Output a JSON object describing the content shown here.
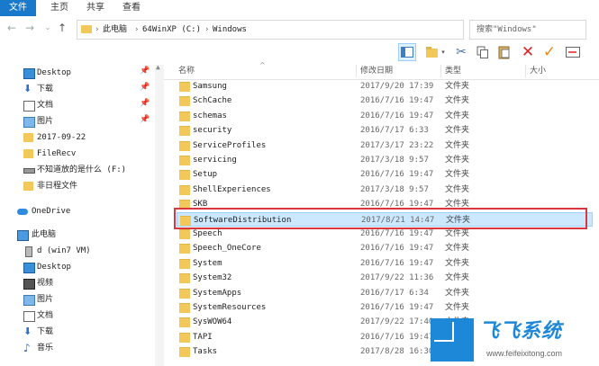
{
  "ribbon": {
    "tabs": [
      "文件",
      "主页",
      "共享",
      "查看"
    ]
  },
  "address": {
    "crumbs": [
      "此电脑",
      "64WinXP (C:)",
      "Windows"
    ],
    "search_placeholder": "搜索\"Windows\""
  },
  "nav": {
    "items": [
      {
        "label": "Desktop",
        "icon": "desktop-icon",
        "pinned": true
      },
      {
        "label": "下载",
        "icon": "download-arrow-icon",
        "pinned": true
      },
      {
        "label": "文档",
        "icon": "document-icon",
        "pinned": true
      },
      {
        "label": "图片",
        "icon": "picture-icon",
        "pinned": true
      },
      {
        "label": "2017-09-22",
        "icon": "folder-icon",
        "pinned": false
      },
      {
        "label": "FileRecv",
        "icon": "folder-icon",
        "pinned": false
      },
      {
        "label": "不知道放的是什么 (F:)",
        "icon": "drive-icon",
        "pinned": false
      },
      {
        "label": "非日程文件",
        "icon": "folder-icon",
        "pinned": false
      },
      {
        "label": "OneDrive",
        "icon": "cloud-icon",
        "pinned": false
      },
      {
        "label": "此电脑",
        "icon": "computer-icon",
        "pinned": false
      },
      {
        "label": "d (win7 VM)",
        "icon": "usb-drive-icon",
        "pinned": false
      },
      {
        "label": "Desktop",
        "icon": "desktop-icon",
        "pinned": false
      },
      {
        "label": "视频",
        "icon": "video-icon",
        "pinned": false
      },
      {
        "label": "图片",
        "icon": "picture-icon",
        "pinned": false
      },
      {
        "label": "文档",
        "icon": "document-icon",
        "pinned": false
      },
      {
        "label": "下载",
        "icon": "download-arrow-icon",
        "pinned": false
      },
      {
        "label": "音乐",
        "icon": "music-note-icon",
        "pinned": false
      }
    ]
  },
  "columns": {
    "name": "名称",
    "date": "修改日期",
    "type": "类型",
    "size": "大小"
  },
  "files": [
    {
      "name": "Samsung",
      "date": "2017/9/20 17:39",
      "type": "文件夹"
    },
    {
      "name": "SchCache",
      "date": "2016/7/16 19:47",
      "type": "文件夹"
    },
    {
      "name": "schemas",
      "date": "2016/7/16 19:47",
      "type": "文件夹"
    },
    {
      "name": "security",
      "date": "2016/7/17 6:33",
      "type": "文件夹"
    },
    {
      "name": "ServiceProfiles",
      "date": "2017/3/17 23:22",
      "type": "文件夹"
    },
    {
      "name": "servicing",
      "date": "2017/3/18 9:57",
      "type": "文件夹"
    },
    {
      "name": "Setup",
      "date": "2016/7/16 19:47",
      "type": "文件夹"
    },
    {
      "name": "ShellExperiences",
      "date": "2017/3/18 9:57",
      "type": "文件夹"
    },
    {
      "name": "SKB",
      "date": "2016/7/16 19:47",
      "type": "文件夹"
    },
    {
      "name": "SoftwareDistribution",
      "date": "2017/8/21 14:47",
      "type": "文件夹"
    },
    {
      "name": "Speech",
      "date": "2016/7/16 19:47",
      "type": "文件夹"
    },
    {
      "name": "Speech_OneCore",
      "date": "2016/7/16 19:47",
      "type": "文件夹"
    },
    {
      "name": "System",
      "date": "2016/7/16 19:47",
      "type": "文件夹"
    },
    {
      "name": "System32",
      "date": "2017/9/22 11:36",
      "type": "文件夹"
    },
    {
      "name": "SystemApps",
      "date": "2016/7/17 6:34",
      "type": "文件夹"
    },
    {
      "name": "SystemResources",
      "date": "2016/7/16 19:47",
      "type": "文件夹"
    },
    {
      "name": "SysWOW64",
      "date": "2017/9/22 17:40",
      "type": "文件夹"
    },
    {
      "name": "TAPI",
      "date": "2016/7/16 19:47",
      "type": "文件夹"
    },
    {
      "name": "Tasks",
      "date": "2017/8/28 16:30",
      "type": "文件夹"
    }
  ],
  "selected_index": 9,
  "watermark": {
    "title": "飞飞系统",
    "url": "www.feifeixitong.com"
  },
  "colors": {
    "accent": "#1979ca",
    "selection": "#cce8ff",
    "highlight": "#d9363e",
    "folder": "#f3c85a"
  }
}
